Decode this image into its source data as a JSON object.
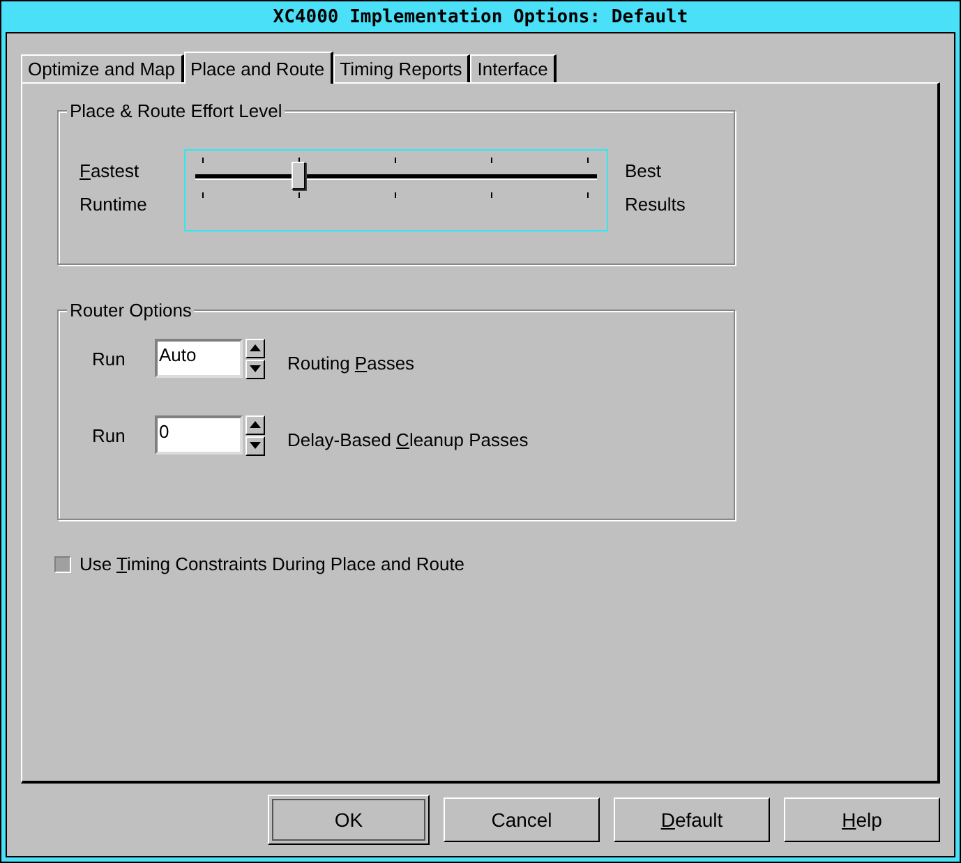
{
  "window": {
    "title": "XC4000 Implementation Options: Default"
  },
  "tabs": [
    {
      "label": "Optimize and Map",
      "selected": false
    },
    {
      "label": "Place and Route",
      "selected": true
    },
    {
      "label": "Timing Reports",
      "selected": false
    },
    {
      "label": "Interface",
      "selected": false
    }
  ],
  "effort": {
    "title": "Place & Route Effort Level",
    "left_top": [
      {
        "text": "F",
        "underlined": true
      },
      {
        "text": "astest",
        "underlined": false
      }
    ],
    "left_bottom": "Runtime",
    "right_top": "Best",
    "right_bottom": "Results",
    "level": 0.25
  },
  "router": {
    "title": "Router Options",
    "rows": [
      {
        "prefix": "Run",
        "value": "Auto",
        "label": [
          {
            "text": "Routing ",
            "underlined": false
          },
          {
            "text": "P",
            "underlined": true
          },
          {
            "text": "asses",
            "underlined": false
          }
        ]
      },
      {
        "prefix": "Run",
        "value": "0",
        "label": [
          {
            "text": "Delay-Based ",
            "underlined": false
          },
          {
            "text": "C",
            "underlined": true
          },
          {
            "text": "leanup Passes",
            "underlined": false
          }
        ]
      }
    ]
  },
  "timing_checkbox": {
    "label": [
      {
        "text": "Use ",
        "underlined": false
      },
      {
        "text": "T",
        "underlined": true
      },
      {
        "text": "iming Constraints During Place and Route",
        "underlined": false
      }
    ],
    "checked": false
  },
  "buttons": [
    {
      "label": [
        {
          "text": "OK",
          "underlined": false
        }
      ],
      "default": true
    },
    {
      "label": [
        {
          "text": "Cancel",
          "underlined": false
        }
      ],
      "default": false
    },
    {
      "label": [
        {
          "text": "D",
          "underlined": true
        },
        {
          "text": "efault",
          "underlined": false
        }
      ],
      "default": false
    },
    {
      "label": [
        {
          "text": "H",
          "underlined": true
        },
        {
          "text": "elp",
          "underlined": false
        }
      ],
      "default": false
    }
  ]
}
